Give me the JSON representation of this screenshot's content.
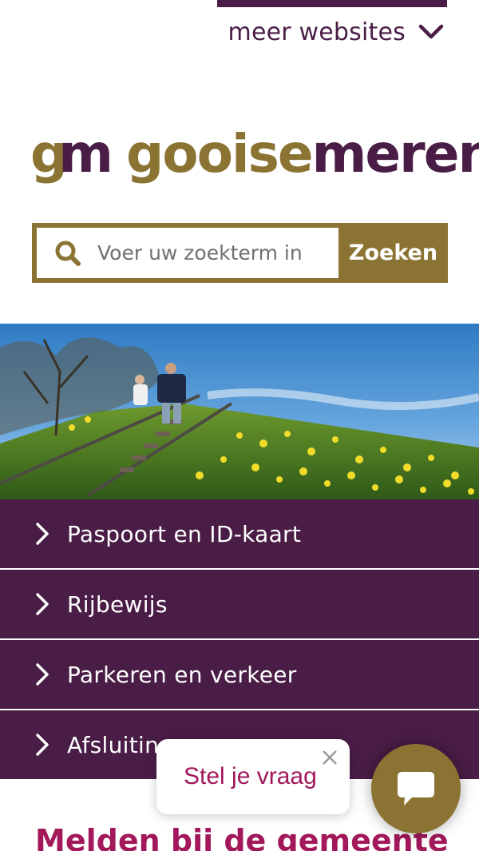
{
  "header": {
    "more_sites_label": "meer websites",
    "more_sites_icon": "chevron-down-icon"
  },
  "logo": {
    "mark_g": "g",
    "mark_m": "m",
    "word_gooise": "gooise",
    "word_meren": "meren"
  },
  "search": {
    "placeholder": "Voer uw zoekterm in",
    "button_label": "Zoeken",
    "icon": "search-icon"
  },
  "menu": {
    "items": [
      {
        "label": "Paspoort en ID-kaart"
      },
      {
        "label": "Rijbewijs"
      },
      {
        "label": "Parkeren en verkeer"
      },
      {
        "label": "Afsluitingen"
      }
    ]
  },
  "section": {
    "title": "Melden bij de gemeente"
  },
  "chat": {
    "prompt": "Stel je vraag",
    "icon": "chat-icon"
  },
  "colors": {
    "purple": "#4a1d46",
    "gold": "#8b7433",
    "magenta": "#a2185b"
  }
}
